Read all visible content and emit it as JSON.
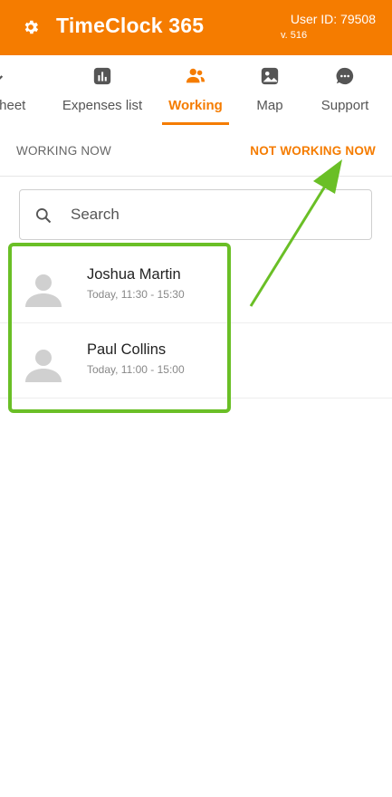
{
  "header": {
    "title": "TimeClock 365",
    "user_id": "User ID: 79508",
    "version": "v. 516",
    "settings_icon": "gear-icon",
    "background": "#f57c00"
  },
  "nav": {
    "items": [
      {
        "label": "sheet",
        "icon": "timesheet-icon"
      },
      {
        "label": "Expenses list",
        "icon": "bar-chart-icon"
      },
      {
        "label": "Working",
        "icon": "people-icon",
        "active": true
      },
      {
        "label": "Map",
        "icon": "map-image-icon"
      },
      {
        "label": "Support",
        "icon": "chat-bubble-icon"
      }
    ]
  },
  "subtabs": {
    "working_now": "WORKING NOW",
    "not_working_now": "NOT WORKING NOW"
  },
  "search": {
    "placeholder": "Search",
    "value": ""
  },
  "employees": [
    {
      "name": "Joshua Martin",
      "time": "Today, 11:30 - 15:30"
    },
    {
      "name": "Paul Collins",
      "time": "Today, 11:00 - 15:00"
    }
  ],
  "colors": {
    "accent": "#f57c00",
    "annotation": "#6abf26"
  }
}
